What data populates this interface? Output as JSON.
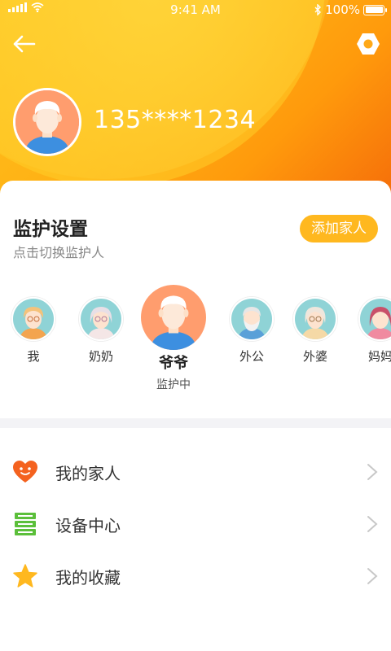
{
  "status_bar": {
    "time": "9:41 AM",
    "battery": "100%"
  },
  "header": {
    "phone": "135****1234"
  },
  "guardian": {
    "title": "监护设置",
    "subtitle": "点击切换监护人",
    "add_label": "添加家人",
    "members": [
      {
        "name": "我",
        "icon": "woman-glasses-avatar"
      },
      {
        "name": "奶奶",
        "icon": "grandma-avatar"
      },
      {
        "name": "爷爷",
        "icon": "grandpa-avatar",
        "active": true,
        "status": "监护中"
      },
      {
        "name": "外公",
        "icon": "bearded-grandpa-avatar"
      },
      {
        "name": "外婆",
        "icon": "grandma-bun-avatar"
      },
      {
        "name": "妈妈",
        "icon": "woman-avatar"
      }
    ]
  },
  "menu": [
    {
      "label": "我的家人",
      "icon": "heart-face-icon",
      "color": "#f4621f"
    },
    {
      "label": "设备中心",
      "icon": "server-icon",
      "color": "#5bbf3a"
    },
    {
      "label": "我的收藏",
      "icon": "star-icon",
      "color": "#ffb81f"
    }
  ],
  "colors": {
    "accent": "#ffb81f",
    "header_start": "#ffc21e",
    "header_end": "#f56d0a"
  }
}
